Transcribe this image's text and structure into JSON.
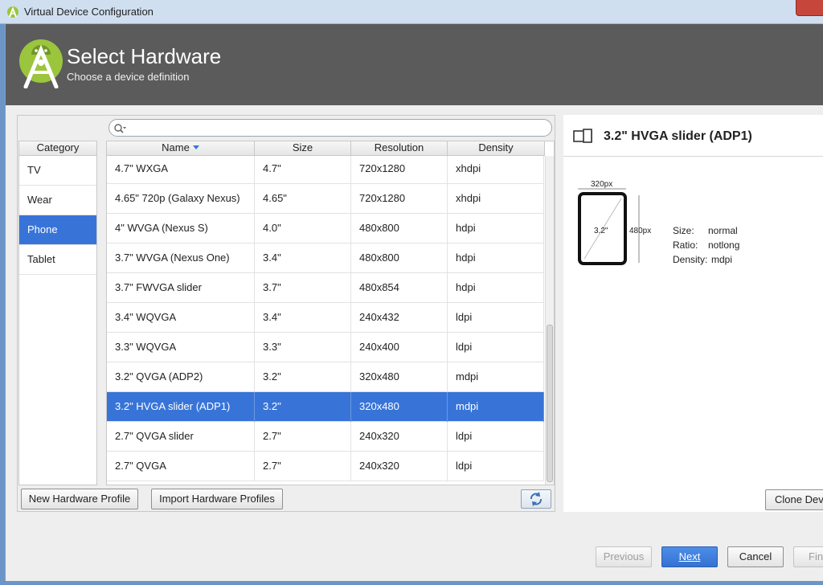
{
  "window": {
    "title": "Virtual Device Configuration"
  },
  "header": {
    "title": "Select Hardware",
    "subtitle": "Choose a device definition"
  },
  "search": {
    "placeholder": "",
    "value": ""
  },
  "category": {
    "header": "Category",
    "items": [
      {
        "label": "TV",
        "selected": false
      },
      {
        "label": "Wear",
        "selected": false
      },
      {
        "label": "Phone",
        "selected": true
      },
      {
        "label": "Tablet",
        "selected": false
      }
    ]
  },
  "table": {
    "columns": [
      "Name",
      "Size",
      "Resolution",
      "Density"
    ],
    "sorted_by": "Name",
    "rows": [
      {
        "name": "4.7\" WXGA",
        "size": "4.7\"",
        "resolution": "720x1280",
        "density": "xhdpi",
        "selected": false
      },
      {
        "name": "4.65\" 720p (Galaxy Nexus)",
        "size": "4.65\"",
        "resolution": "720x1280",
        "density": "xhdpi",
        "selected": false
      },
      {
        "name": "4\" WVGA (Nexus S)",
        "size": "4.0\"",
        "resolution": "480x800",
        "density": "hdpi",
        "selected": false
      },
      {
        "name": "3.7\" WVGA (Nexus One)",
        "size": "3.4\"",
        "resolution": "480x800",
        "density": "hdpi",
        "selected": false
      },
      {
        "name": "3.7\" FWVGA slider",
        "size": "3.7\"",
        "resolution": "480x854",
        "density": "hdpi",
        "selected": false
      },
      {
        "name": "3.4\" WQVGA",
        "size": "3.4\"",
        "resolution": "240x432",
        "density": "ldpi",
        "selected": false
      },
      {
        "name": "3.3\" WQVGA",
        "size": "3.3\"",
        "resolution": "240x400",
        "density": "ldpi",
        "selected": false
      },
      {
        "name": "3.2\" QVGA (ADP2)",
        "size": "3.2\"",
        "resolution": "320x480",
        "density": "mdpi",
        "selected": false
      },
      {
        "name": "3.2\" HVGA slider (ADP1)",
        "size": "3.2\"",
        "resolution": "320x480",
        "density": "mdpi",
        "selected": true
      },
      {
        "name": "2.7\" QVGA slider",
        "size": "2.7\"",
        "resolution": "240x320",
        "density": "ldpi",
        "selected": false
      },
      {
        "name": "2.7\" QVGA",
        "size": "2.7\"",
        "resolution": "240x320",
        "density": "ldpi",
        "selected": false
      }
    ]
  },
  "buttons": {
    "new_profile": "New Hardware Profile",
    "import_profiles": "Import Hardware Profiles",
    "clone_device": "Clone Devi"
  },
  "detail": {
    "title": "3.2\" HVGA slider (ADP1)",
    "width_label": "320px",
    "height_label": "480px",
    "diagonal_label": "3.2\"",
    "size_label": "Size:",
    "size_value": "normal",
    "ratio_label": "Ratio:",
    "ratio_value": "notlong",
    "density_label": "Density:",
    "density_value": "mdpi"
  },
  "footer": {
    "previous": "Previous",
    "next": "Next",
    "cancel": "Cancel",
    "finish": "Fin"
  },
  "colors": {
    "header_bg": "#5b5b5b",
    "selection": "#3874d8",
    "android_green": "#9bc53d"
  }
}
